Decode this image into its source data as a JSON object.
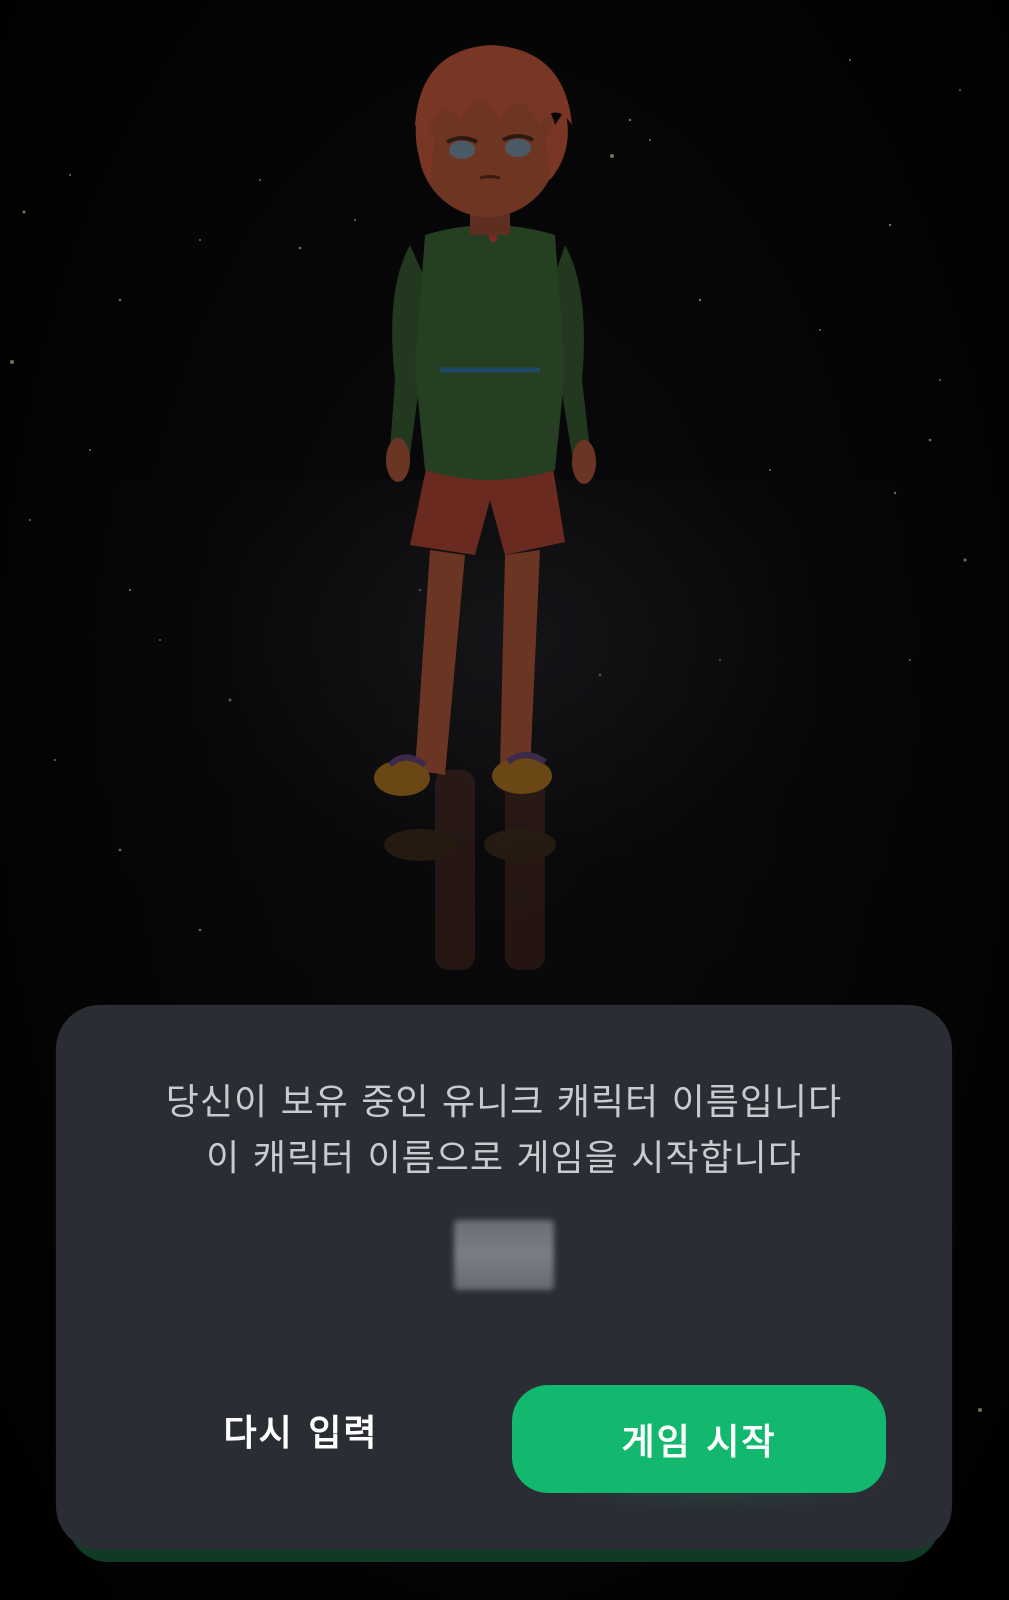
{
  "dialog": {
    "message_line1": "당신이 보유 중인 유니크 캐릭터 이름입니다",
    "message_line2": "이 캐릭터 이름으로 게임을 시작합니다",
    "retry_label": "다시 입력",
    "start_label": "게임 시작"
  },
  "colors": {
    "dialog_background": "#2a2d34",
    "accent": "#12b86d",
    "message_text": "#c9cbcf"
  },
  "icons": {
    "character": "character-illustration"
  }
}
